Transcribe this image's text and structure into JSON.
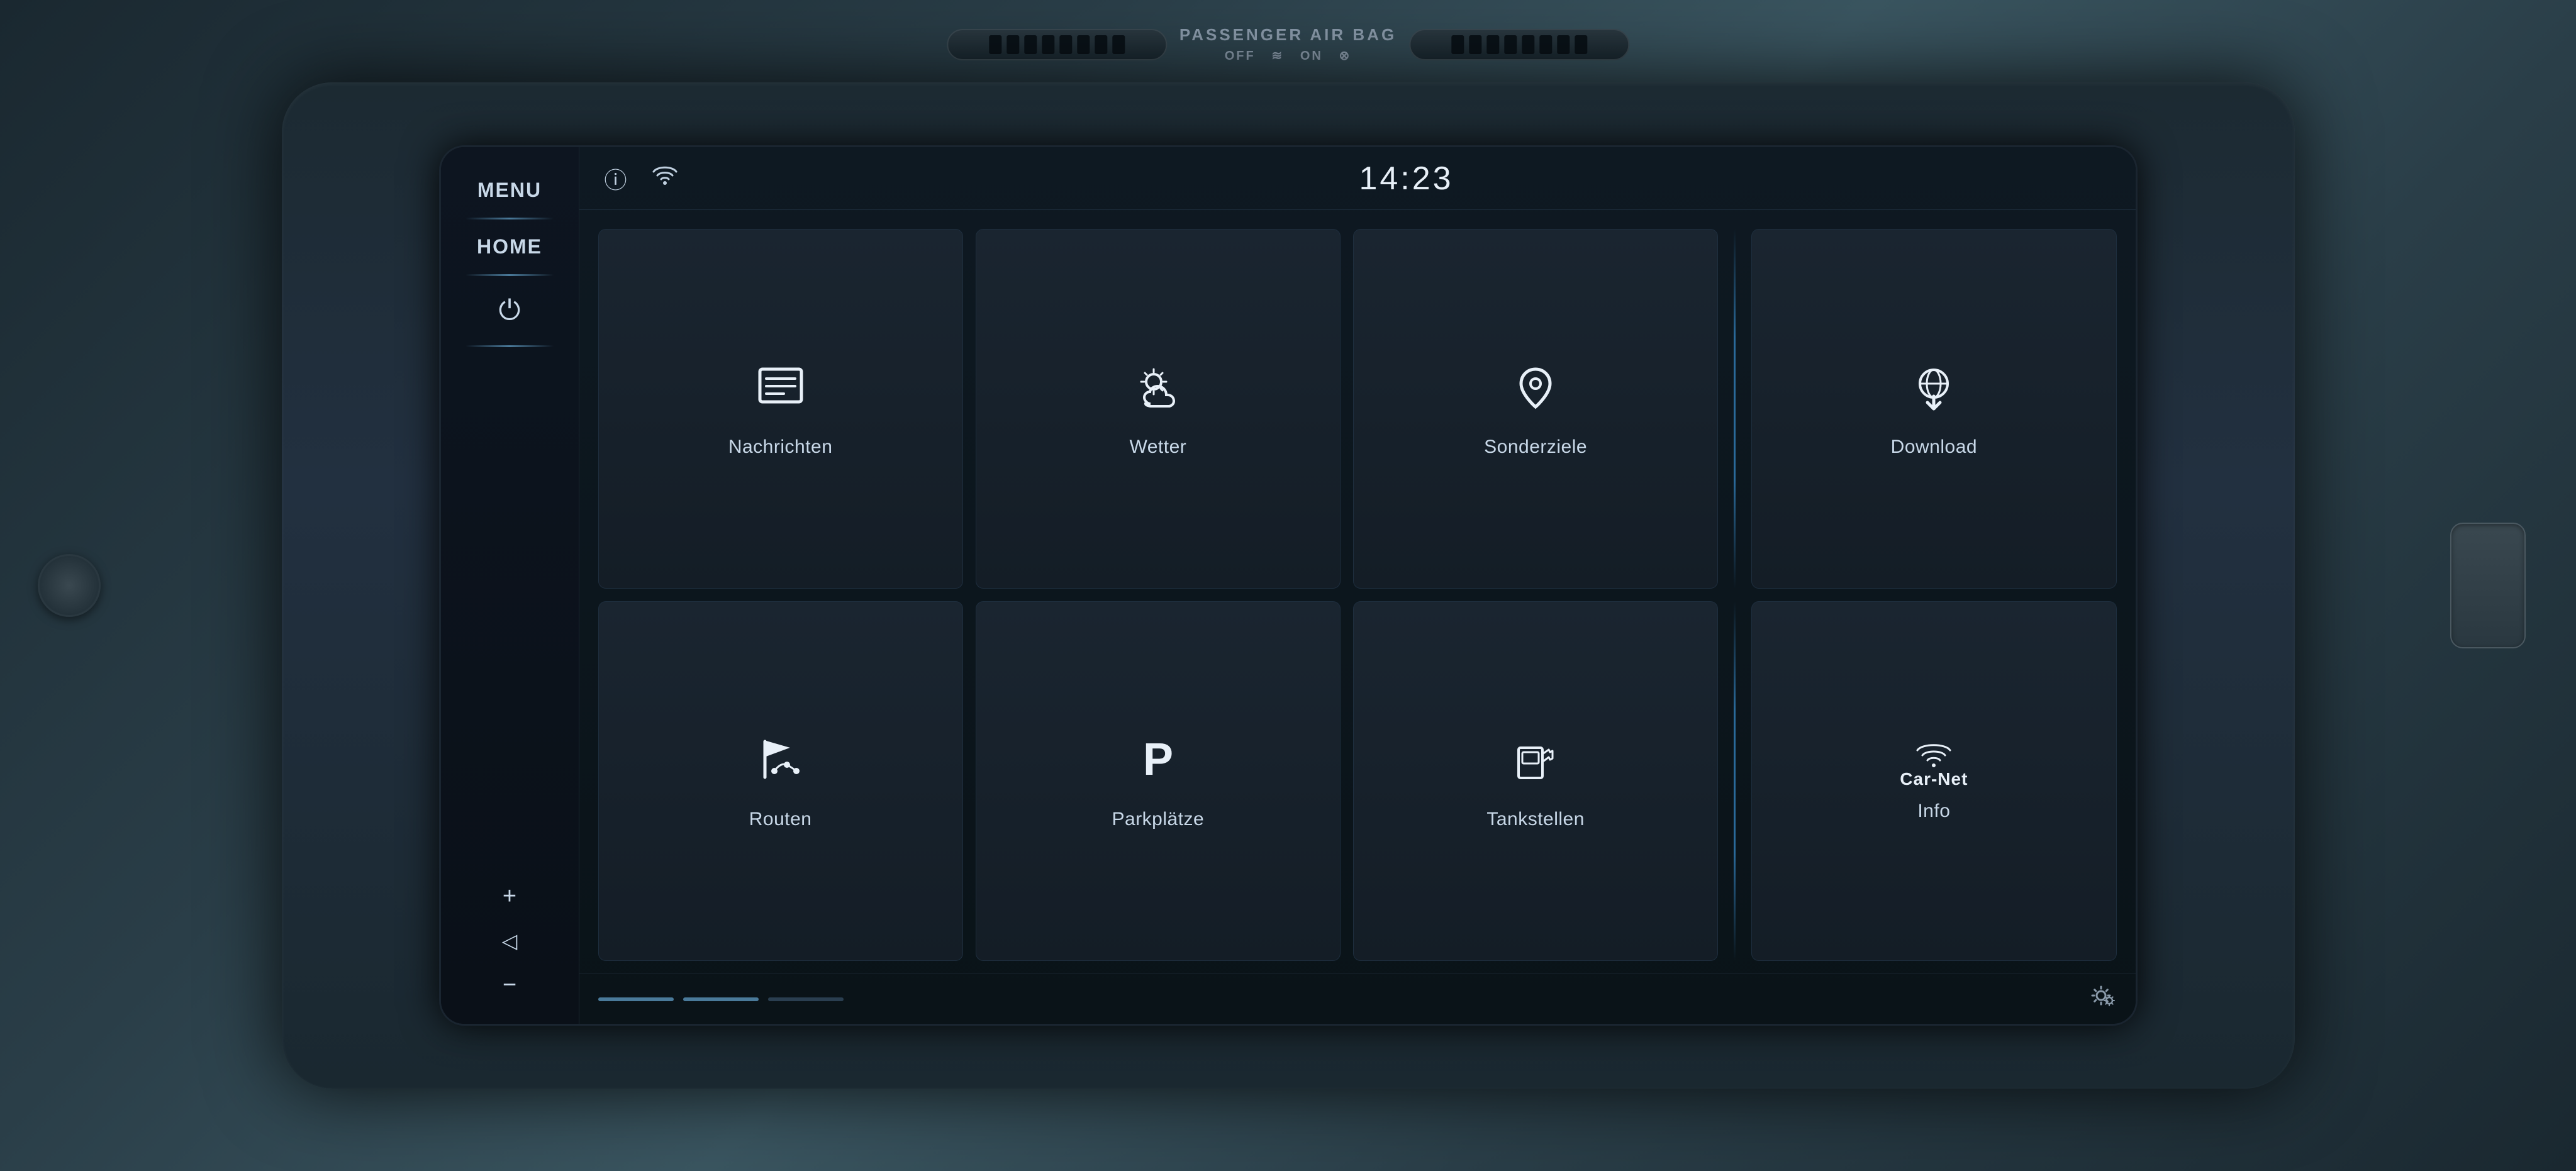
{
  "header": {
    "time": "14:23",
    "wifi_icon": "wifi",
    "info_icon": "ⓘ"
  },
  "sidebar": {
    "menu_label": "MENU",
    "home_label": "HOME",
    "power_icon": "⏻"
  },
  "grid": {
    "tiles": [
      {
        "id": "nachrichten",
        "label": "Nachrichten",
        "icon": "news"
      },
      {
        "id": "wetter",
        "label": "Wetter",
        "icon": "weather"
      },
      {
        "id": "sonderziele",
        "label": "Sonderziele",
        "icon": "poi"
      },
      {
        "id": "download",
        "label": "Download",
        "icon": "download"
      },
      {
        "id": "routen",
        "label": "Routen",
        "icon": "routes"
      },
      {
        "id": "parkplaetze",
        "label": "Parkplätze",
        "icon": "parking"
      },
      {
        "id": "tankstellen",
        "label": "Tankstellen",
        "icon": "fuel"
      },
      {
        "id": "info",
        "label": "Info",
        "icon": "carnet"
      }
    ]
  },
  "bottom": {
    "settings_icon": "⚙"
  },
  "airbag": {
    "label": "PASSENGER AIR BAG"
  }
}
